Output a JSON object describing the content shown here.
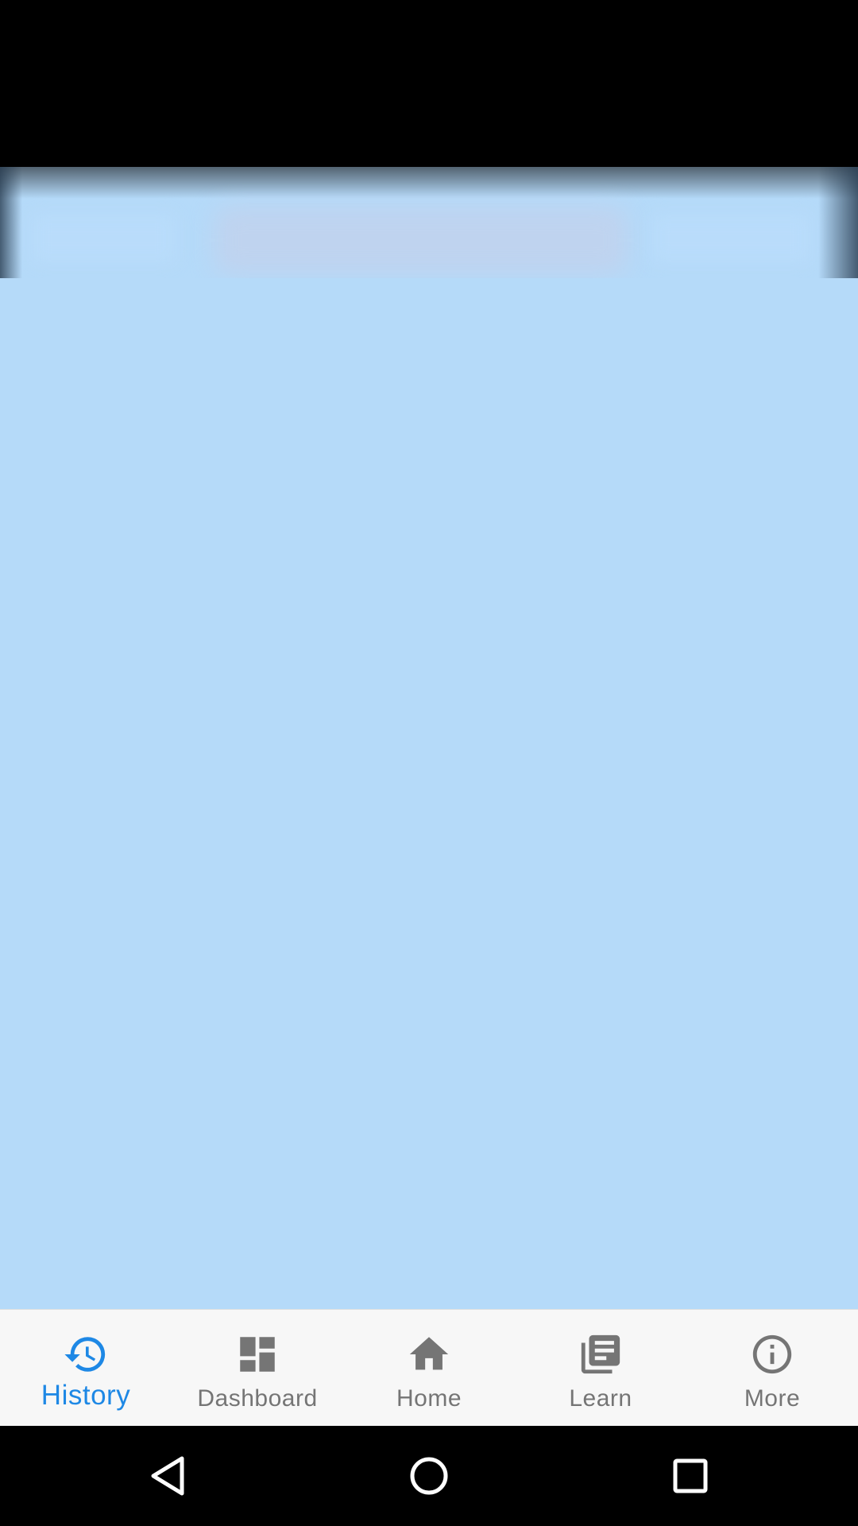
{
  "colors": {
    "content_background": "#b5daf9",
    "bottom_nav_background": "#f7f7f7",
    "active_color": "#1e88e5",
    "inactive_color": "#757575",
    "system_bar": "#000000"
  },
  "bottom_nav": {
    "active_index": 0,
    "items": [
      {
        "label": "History",
        "icon": "history-icon",
        "active": true
      },
      {
        "label": "Dashboard",
        "icon": "dashboard-icon",
        "active": false
      },
      {
        "label": "Home",
        "icon": "home-icon",
        "active": false
      },
      {
        "label": "Learn",
        "icon": "library-books-icon",
        "active": false
      },
      {
        "label": "More",
        "icon": "info-icon",
        "active": false
      }
    ]
  },
  "system_nav": {
    "buttons": [
      "back-icon",
      "home-circle-icon",
      "recents-icon"
    ]
  }
}
